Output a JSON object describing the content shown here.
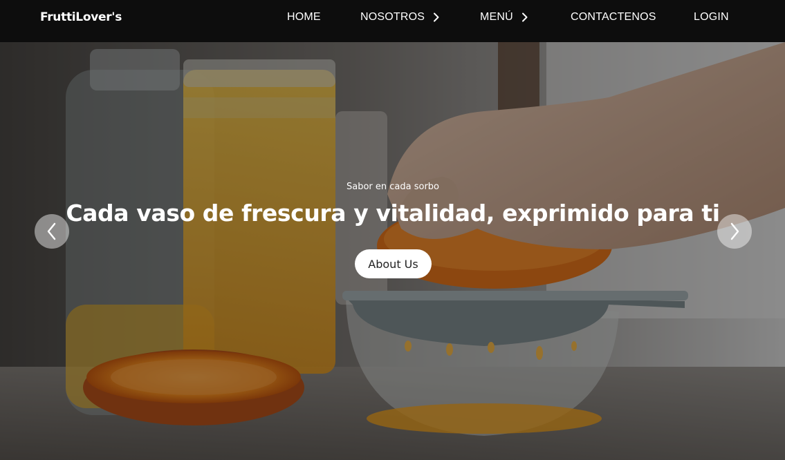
{
  "brand": "FruttiLover's",
  "nav": {
    "home": "HOME",
    "nosotros": "NOSOTROS",
    "menu": "MENÚ",
    "contact": "CONTACTENOS",
    "login": "LOGIN"
  },
  "hero": {
    "subtitle": "Sabor en cada sorbo",
    "headline": "Cada vaso de frescura y vitalidad, exprimido para ti",
    "button_label": "About Us",
    "image_description_icon": "orange-juicer-photo"
  },
  "carousel": {
    "prev_icon": "chevron-left-icon",
    "next_icon": "chevron-right-icon"
  },
  "colors": {
    "navbar": "#0d0d0d",
    "text": "#ffffff",
    "button_bg": "#ffffff",
    "button_text": "#222222"
  }
}
